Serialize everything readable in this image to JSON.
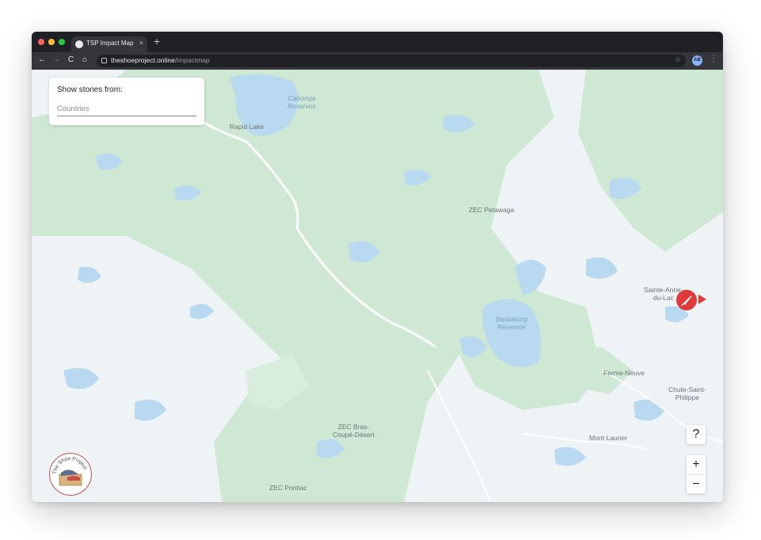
{
  "browser": {
    "tab_title": "TSP Impact Map",
    "tab_close": "×",
    "new_tab": "+",
    "url_domain": "theshoeproject.online",
    "url_path": "/impactmap",
    "avatar_initials": "AB",
    "back": "←",
    "forward": "→",
    "reload": "C",
    "home": "⌂",
    "star": "☆",
    "menu": "⋮",
    "traffic_lights": [
      "#ff5f57",
      "#febc2e",
      "#28c840"
    ]
  },
  "filter": {
    "title": "Show stories from:",
    "placeholder": "Countries"
  },
  "map": {
    "labels": {
      "rapid_lake": "Rapid Lake",
      "cabonga": "Cabonga\nReservoir",
      "zec_petawaga": "ZEC Petawaga",
      "baskatong": "Baskatong\nReservoir",
      "sainte_anne": "Sainte-Anne-\ndu-Lac",
      "ferme_neuve": "Ferme-Neuve",
      "chute_saint_philippe": "Chute-Saint-\nPhilippe",
      "mont_laurier": "Mont-Laurier",
      "zec_bras_coupe": "ZEC Bras-\nCoupé-Désert",
      "zec_pontiac": "ZEC Pontiac"
    },
    "colors": {
      "land": "#eef3f6",
      "forest": "#cfe8d4",
      "water": "#b8d9ef",
      "road": "#ffffff",
      "marker": "#e03a3a"
    },
    "zoom_in": "+",
    "zoom_out": "−",
    "help": "?"
  },
  "logo": {
    "text": "The Shoe Project",
    "icon": "shoe-logo-icon"
  },
  "icons": {
    "marker": "feather-pen-icon"
  }
}
